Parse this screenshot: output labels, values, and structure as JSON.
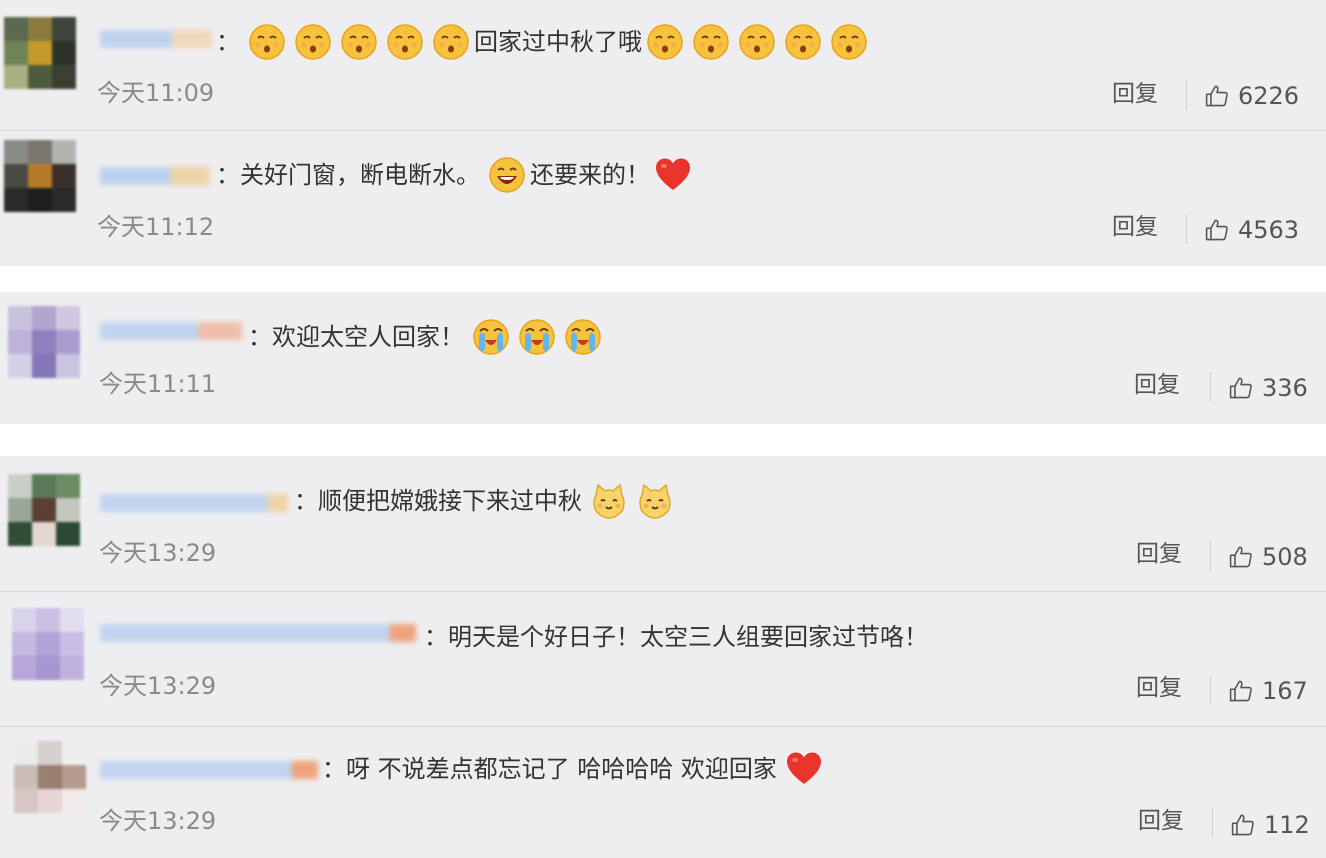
{
  "comments": [
    {
      "text": "：",
      "text_after": "回家过中秋了哦",
      "emoji_before": [
        "kiss-emoji",
        "kiss-emoji",
        "kiss-emoji",
        "kiss-emoji",
        "kiss-emoji"
      ],
      "emoji_after": [
        "kiss-emoji",
        "kiss-emoji",
        "kiss-emoji",
        "kiss-emoji",
        "kiss-emoji"
      ],
      "time": "今天11:09",
      "reply_label": "回复",
      "likes": "6226"
    },
    {
      "text": "：关好门窗，断电断水。",
      "text_after": "还要来的！",
      "emoji_before": [
        "laugh-emoji"
      ],
      "emoji_after": [
        "heart-emoji"
      ],
      "time": "今天11:12",
      "reply_label": "回复",
      "likes": "4563"
    },
    {
      "text": "：欢迎太空人回家！",
      "text_after": "",
      "emoji_before": [
        "cry-emoji",
        "cry-emoji",
        "cry-emoji"
      ],
      "emoji_after": [],
      "time": "今天11:11",
      "reply_label": "回复",
      "likes": "336"
    },
    {
      "text": "：顺便把嫦娥接下来过中秋",
      "text_after": "",
      "emoji_before": [
        "cat-emoji",
        "cat-emoji"
      ],
      "emoji_after": [],
      "time": "今天13:29",
      "reply_label": "回复",
      "likes": "508"
    },
    {
      "text": "：明天是个好日子！太空三人组要回家过节咯！",
      "text_after": "",
      "emoji_before": [],
      "emoji_after": [],
      "time": "今天13:29",
      "reply_label": "回复",
      "likes": "167"
    },
    {
      "text": "：呀 不说差点都忘记了 哈哈哈哈 欢迎回家",
      "text_after": "",
      "emoji_before": [
        "heart-emoji"
      ],
      "emoji_after": [],
      "time": "今天13:29",
      "reply_label": "回复",
      "likes": "112"
    }
  ],
  "colors": {
    "background": "#eeeef0",
    "timestamp": "#8a8a8a",
    "text": "#333333",
    "heart": "#e8342a"
  }
}
